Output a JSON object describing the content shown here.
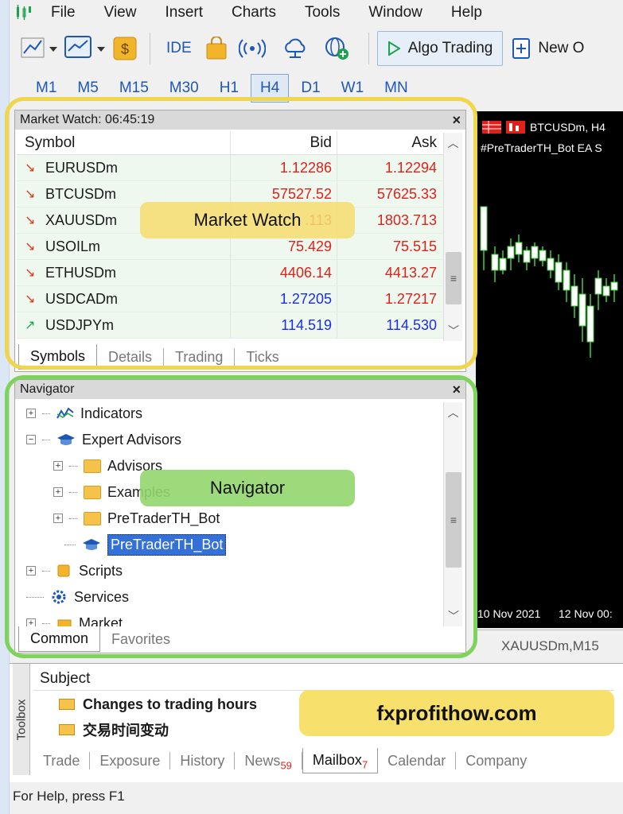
{
  "menu": {
    "items": [
      "File",
      "View",
      "Insert",
      "Charts",
      "Tools",
      "Window",
      "Help"
    ]
  },
  "toolbar": {
    "ide_label": "IDE",
    "algo_label": "Algo Trading",
    "new_order_label": "New O"
  },
  "timeframes": [
    "M1",
    "M5",
    "M15",
    "M30",
    "H1",
    "H4",
    "D1",
    "W1",
    "MN"
  ],
  "timeframe_active": "H4",
  "market_watch": {
    "title": "Market Watch: 06:45:19",
    "columns": [
      "Symbol",
      "Bid",
      "Ask"
    ],
    "rows": [
      {
        "symbol": "EURUSDm",
        "bid": "1.12286",
        "ask": "1.12294",
        "dir": "down",
        "bid_color": "red",
        "ask_color": "red"
      },
      {
        "symbol": "BTCUSDm",
        "bid": "57527.52",
        "ask": "57625.33",
        "dir": "down",
        "bid_color": "red",
        "ask_color": "red"
      },
      {
        "symbol": "XAUUSDm",
        "bid": ".113",
        "ask": "1803.713",
        "dir": "down",
        "bid_color": "red",
        "ask_color": "red"
      },
      {
        "symbol": "USOILm",
        "bid": "75.429",
        "ask": "75.515",
        "dir": "down",
        "bid_color": "red",
        "ask_color": "red"
      },
      {
        "symbol": "ETHUSDm",
        "bid": "4406.14",
        "ask": "4413.27",
        "dir": "down",
        "bid_color": "red",
        "ask_color": "red"
      },
      {
        "symbol": "USDCADm",
        "bid": "1.27205",
        "ask": "1.27217",
        "dir": "down",
        "bid_color": "blue",
        "ask_color": "red"
      },
      {
        "symbol": "USDJPYm",
        "bid": "114.519",
        "ask": "114.530",
        "dir": "up",
        "bid_color": "blue",
        "ask_color": "blue"
      }
    ],
    "tabs": [
      "Symbols",
      "Details",
      "Trading",
      "Ticks"
    ],
    "active_tab": "Symbols"
  },
  "navigator": {
    "title": "Navigator",
    "items": [
      "Indicators",
      "Expert Advisors",
      "Advisors",
      "Examples",
      "PreTraderTH_Bot",
      "PreTraderTH_Bot",
      "Scripts",
      "Services",
      "Market"
    ],
    "tabs": [
      "Common",
      "Favorites"
    ]
  },
  "chart": {
    "symbol_title": "BTCUSDm, H4",
    "ea_label": "#PreTraderTH_Bot EA S",
    "dates": [
      "10 Nov 2021",
      "12 Nov 00:"
    ],
    "footer_tab": "XAUUSDm,M15"
  },
  "toolbox": {
    "side_label": "Toolbox",
    "subject_header": "Subject",
    "mails": [
      "Changes to trading hours",
      "交易时间变动"
    ],
    "tabs": [
      {
        "label": "Trade",
        "count": ""
      },
      {
        "label": "Exposure",
        "count": ""
      },
      {
        "label": "History",
        "count": ""
      },
      {
        "label": "News",
        "count": "59"
      },
      {
        "label": "Mailbox",
        "count": "7"
      },
      {
        "label": "Calendar",
        "count": ""
      },
      {
        "label": "Company",
        "count": ""
      }
    ],
    "active_tab": "Mailbox"
  },
  "statusbar": {
    "text": "For Help, press F1"
  },
  "annotations": {
    "market_watch_label": "Market Watch",
    "navigator_label": "Navigator",
    "site_label": "fxprofithow.com"
  },
  "colors": {
    "annotation_yellow": "#f0d64a",
    "annotation_green": "#7ed35c",
    "price_red": "#e0211b",
    "price_blue": "#1a2fe0",
    "selection_blue": "#3371d8"
  }
}
